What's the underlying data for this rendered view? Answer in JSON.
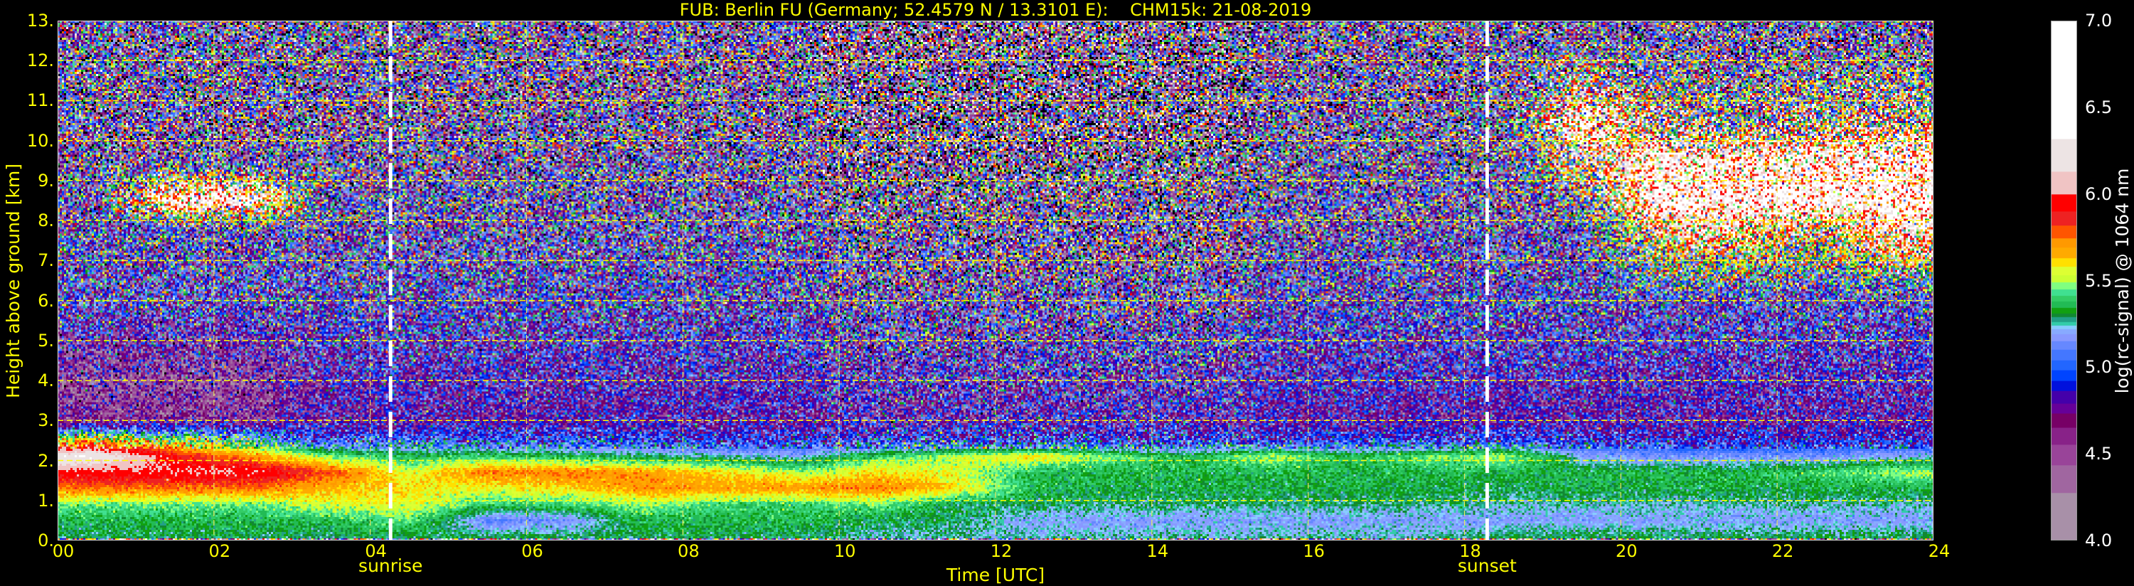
{
  "chart_data": {
    "type": "heatmap",
    "title": "FUB: Berlin FU (Germany; 52.4579 N / 13.3101 E):    CHM15k: 21-08-2019",
    "xlabel": "Time [UTC]",
    "ylabel": "Height above ground [km]",
    "xlim": [
      0,
      24
    ],
    "ylim": [
      0,
      13
    ],
    "grid": true,
    "x_ticks": [
      0,
      2,
      4,
      6,
      8,
      10,
      12,
      14,
      16,
      18,
      20,
      22,
      24
    ],
    "x_tick_labels": [
      "00",
      "02",
      "04",
      "06",
      "08",
      "10",
      "12",
      "14",
      "16",
      "18",
      "20",
      "22",
      "24"
    ],
    "y_ticks": [
      0,
      1,
      2,
      3,
      4,
      5,
      6,
      7,
      8,
      9,
      10,
      11,
      12,
      13
    ],
    "y_tick_labels": [
      "0.",
      "1.",
      "2.",
      "3.",
      "4.",
      "5.",
      "6.",
      "7.",
      "8.",
      "9.",
      "10.",
      "11.",
      "12.",
      "13."
    ],
    "annotations": [
      {
        "label": "sunrise",
        "x": 4.26
      },
      {
        "label": "sunset",
        "x": 18.29
      }
    ],
    "colorbar": {
      "label": "log(rc-signal) @ 1064 nm",
      "min": 4.0,
      "max": 7.0,
      "ticks": [
        4.0,
        4.5,
        5.0,
        5.5,
        6.0,
        6.5,
        7.0
      ],
      "tick_labels": [
        "4.0",
        "4.5",
        "5.0",
        "5.5",
        "6.0",
        "6.5",
        "7.0"
      ],
      "below_color": "#000000",
      "levels": [
        {
          "from": 4.0,
          "color": "#a890a8"
        },
        {
          "from": 4.27,
          "color": "#a066a0"
        },
        {
          "from": 4.43,
          "color": "#994499"
        },
        {
          "from": 4.55,
          "color": "#882288"
        },
        {
          "from": 4.65,
          "color": "#770066"
        },
        {
          "from": 4.73,
          "color": "#660099"
        },
        {
          "from": 4.79,
          "color": "#4400aa"
        },
        {
          "from": 4.86,
          "color": "#0011dd"
        },
        {
          "from": 4.92,
          "color": "#0044ff"
        },
        {
          "from": 4.98,
          "color": "#2266ff"
        },
        {
          "from": 5.04,
          "color": "#4477ff"
        },
        {
          "from": 5.1,
          "color": "#6688ff"
        },
        {
          "from": 5.15,
          "color": "#8899ff"
        },
        {
          "from": 5.19,
          "color": "#88aaff"
        },
        {
          "from": 5.22,
          "color": "#88ccff"
        },
        {
          "from": 5.24,
          "color": "#33ccaa"
        },
        {
          "from": 5.26,
          "color": "#22a088"
        },
        {
          "from": 5.29,
          "color": "#118833"
        },
        {
          "from": 5.31,
          "color": "#11a011"
        },
        {
          "from": 5.34,
          "color": "#22bb55"
        },
        {
          "from": 5.38,
          "color": "#33cc66"
        },
        {
          "from": 5.41,
          "color": "#40e090"
        },
        {
          "from": 5.45,
          "color": "#80ff80"
        },
        {
          "from": 5.49,
          "color": "#ccff33"
        },
        {
          "from": 5.53,
          "color": "#ddff33"
        },
        {
          "from": 5.58,
          "color": "#ffe000"
        },
        {
          "from": 5.63,
          "color": "#ffaa00"
        },
        {
          "from": 5.69,
          "color": "#ff9900"
        },
        {
          "from": 5.745,
          "color": "#ff5500"
        },
        {
          "from": 5.82,
          "color": "#ee2222"
        },
        {
          "from": 5.9,
          "color": "#ff0000"
        },
        {
          "from": 6.0,
          "color": "#f0c4c4"
        },
        {
          "from": 6.13,
          "color": "#ede4e4"
        },
        {
          "from": 6.32,
          "color": "#ffffff"
        }
      ]
    },
    "z": {
      "x_hours": [
        0.5,
        1.5,
        2.5,
        3.5,
        4.5,
        5.5,
        6.5,
        7.5,
        8.5,
        9.5,
        10.5,
        11.5,
        12.5,
        13.5,
        14.5,
        15.5,
        16.5,
        17.5,
        18.5,
        19.5,
        20.5,
        21.5,
        22.5,
        23.5
      ],
      "heights_km": [
        0.1,
        0.5,
        0.9,
        1.3,
        1.7,
        2.1,
        2.5,
        3.0,
        4.0,
        6.0,
        7.8,
        8.5,
        9.5,
        10.5,
        12.5
      ],
      "values": [
        [
          5.3,
          5.3,
          5.3,
          5.3,
          5.3,
          5.3,
          5.3,
          5.3,
          5.3,
          5.3,
          5.25,
          5.25,
          5.25,
          5.25,
          5.25,
          5.25,
          5.25,
          5.25,
          5.3,
          5.3,
          5.3,
          5.3,
          5.3,
          5.3
        ],
        [
          5.35,
          5.35,
          5.35,
          5.35,
          5.45,
          5.1,
          5.15,
          5.35,
          5.35,
          5.35,
          5.3,
          5.3,
          5.18,
          5.18,
          5.18,
          5.18,
          5.18,
          5.18,
          5.18,
          5.18,
          5.18,
          5.18,
          5.18,
          5.18
        ],
        [
          5.45,
          5.45,
          5.45,
          5.55,
          5.55,
          5.4,
          5.4,
          5.5,
          5.4,
          5.4,
          5.45,
          5.3,
          5.3,
          5.28,
          5.28,
          5.28,
          5.28,
          5.28,
          5.25,
          5.25,
          5.25,
          5.25,
          5.25,
          5.25
        ],
        [
          5.75,
          5.75,
          5.75,
          5.65,
          5.6,
          5.55,
          5.6,
          5.7,
          5.7,
          5.7,
          5.75,
          5.6,
          5.35,
          5.33,
          5.33,
          5.33,
          5.33,
          5.33,
          5.3,
          5.33,
          5.33,
          5.33,
          5.33,
          5.33
        ],
        [
          5.95,
          6.0,
          6.0,
          5.8,
          5.55,
          5.75,
          5.75,
          5.7,
          5.6,
          5.5,
          5.6,
          5.55,
          5.35,
          5.35,
          5.35,
          5.35,
          5.35,
          5.35,
          5.35,
          5.35,
          5.35,
          5.35,
          5.4,
          5.5
        ],
        [
          6.3,
          5.9,
          5.7,
          5.45,
          5.35,
          5.4,
          5.35,
          5.3,
          5.25,
          5.2,
          5.4,
          5.5,
          5.6,
          5.45,
          5.35,
          5.5,
          5.35,
          5.45,
          5.5,
          5.2,
          5.15,
          5.15,
          5.15,
          5.2
        ],
        [
          5.6,
          5.5,
          5.3,
          5.0,
          5.05,
          5.0,
          5.0,
          5.0,
          4.95,
          4.95,
          4.95,
          4.95,
          4.95,
          4.95,
          4.95,
          4.95,
          4.95,
          4.95,
          5.0,
          4.95,
          4.9,
          4.9,
          4.9,
          4.9
        ],
        [
          4.6,
          4.6,
          4.6,
          4.75,
          4.75,
          4.75,
          4.75,
          4.75,
          4.75,
          4.75,
          4.75,
          4.75,
          4.75,
          4.75,
          4.75,
          4.75,
          4.75,
          4.75,
          4.75,
          4.75,
          4.75,
          4.75,
          4.75,
          4.75
        ],
        [
          4.5,
          4.5,
          4.5,
          4.8,
          4.8,
          4.8,
          4.8,
          4.8,
          4.8,
          4.8,
          4.8,
          4.8,
          4.8,
          4.8,
          4.8,
          4.8,
          4.8,
          4.8,
          4.8,
          4.8,
          4.8,
          4.8,
          4.8,
          4.8
        ],
        [
          4.9,
          4.9,
          4.9,
          4.9,
          4.9,
          4.9,
          4.9,
          4.9,
          4.9,
          4.9,
          4.9,
          4.9,
          4.9,
          4.9,
          4.9,
          4.9,
          4.9,
          4.9,
          4.9,
          4.9,
          4.9,
          4.9,
          4.9,
          4.9
        ],
        [
          4.9,
          4.9,
          4.9,
          4.9,
          4.9,
          4.9,
          4.9,
          4.9,
          4.9,
          4.9,
          4.9,
          4.9,
          4.9,
          4.9,
          4.9,
          4.9,
          4.9,
          4.9,
          4.9,
          4.9,
          5.9,
          6.0,
          5.6,
          6.2
        ],
        [
          4.9,
          6.4,
          6.3,
          4.9,
          4.9,
          4.9,
          4.9,
          4.9,
          4.9,
          4.9,
          4.9,
          4.9,
          4.9,
          4.9,
          4.9,
          4.9,
          4.9,
          4.9,
          4.9,
          5.2,
          6.5,
          6.4,
          6.5,
          6.4
        ],
        [
          4.9,
          4.9,
          4.9,
          4.9,
          4.9,
          4.9,
          4.9,
          4.9,
          4.9,
          4.9,
          4.9,
          4.9,
          4.9,
          4.9,
          4.9,
          4.9,
          4.9,
          4.9,
          4.9,
          5.8,
          6.3,
          6.2,
          6.3,
          6.3
        ],
        [
          4.9,
          4.9,
          4.9,
          4.9,
          4.9,
          4.9,
          4.9,
          4.9,
          4.9,
          4.9,
          4.9,
          4.9,
          4.9,
          4.9,
          4.9,
          4.9,
          4.9,
          4.9,
          4.9,
          6.2,
          5.5,
          5.3,
          5.5,
          5.6
        ],
        [
          4.9,
          4.9,
          4.9,
          4.9,
          4.9,
          4.9,
          4.9,
          4.9,
          4.9,
          4.9,
          4.9,
          4.9,
          4.9,
          4.9,
          4.9,
          4.9,
          4.9,
          4.9,
          4.9,
          4.9,
          4.9,
          4.9,
          4.9,
          4.9
        ]
      ]
    }
  }
}
